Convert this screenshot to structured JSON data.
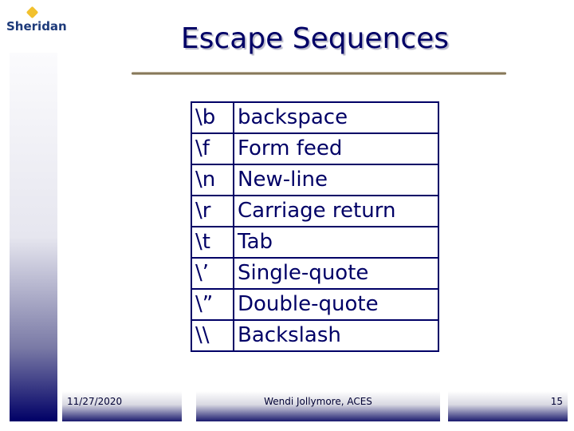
{
  "logo": {
    "text": "Sheridan"
  },
  "title": "Escape Sequences",
  "table": {
    "rows": [
      {
        "code": "\\b",
        "meaning": "backspace"
      },
      {
        "code": "\\f",
        "meaning": "Form feed"
      },
      {
        "code": "\\n",
        "meaning": "New-line"
      },
      {
        "code": "\\r",
        "meaning": "Carriage return"
      },
      {
        "code": "\\t",
        "meaning": "Tab"
      },
      {
        "code": "\\’",
        "meaning": "Single-quote"
      },
      {
        "code": "\\”",
        "meaning": "Double-quote"
      },
      {
        "code": "\\\\",
        "meaning": "Backslash"
      }
    ]
  },
  "footer": {
    "date": "11/27/2020",
    "author": "Wendi Jollymore, ACES",
    "page": "15"
  },
  "colors": {
    "text": "#000066",
    "accent": "#000066",
    "logo": "#1d3a7a"
  }
}
